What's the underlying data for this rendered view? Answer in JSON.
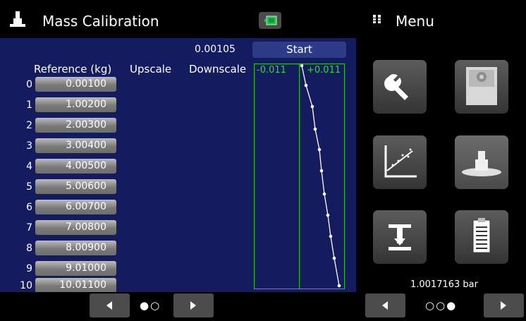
{
  "header": {
    "title": "Mass Calibration",
    "title_icon": "mass-weight-icon",
    "status_icon": "battery-icon",
    "menu_icon": "grid-dots-icon",
    "menu_title": "Menu"
  },
  "calibration": {
    "top_value": "0.00105",
    "start_label": "Start",
    "columns": {
      "reference": "Reference (kg)",
      "upscale": "Upscale",
      "downscale": "Downscale"
    },
    "rows": [
      {
        "index": "0",
        "reference": "0.00100"
      },
      {
        "index": "1",
        "reference": "1.00200"
      },
      {
        "index": "2",
        "reference": "2.00300"
      },
      {
        "index": "3",
        "reference": "3.00400"
      },
      {
        "index": "4",
        "reference": "4.00500"
      },
      {
        "index": "5",
        "reference": "5.00600"
      },
      {
        "index": "6",
        "reference": "6.00700"
      },
      {
        "index": "7",
        "reference": "7.00800"
      },
      {
        "index": "8",
        "reference": "8.00900"
      },
      {
        "index": "9",
        "reference": "9.01000"
      },
      {
        "index": "10",
        "reference": "10.01100"
      }
    ],
    "chart": {
      "left_label": "-0.011",
      "right_label": "+0.011",
      "colors": {
        "border": "#2bbf2b",
        "label": "#3ad33a",
        "line": "#ffffff"
      }
    },
    "page_dots": "●○"
  },
  "menu": {
    "items": [
      {
        "name": "settings",
        "icon": "wrench-icon"
      },
      {
        "name": "sensor",
        "icon": "sensor-icon"
      },
      {
        "name": "calibration-chart",
        "icon": "chart-icon"
      },
      {
        "name": "mass-calibration",
        "icon": "mass-weight-icon",
        "active": true
      },
      {
        "name": "leak-test",
        "icon": "leak-test-icon"
      },
      {
        "name": "report",
        "icon": "clipboard-icon"
      }
    ],
    "pressure_reading": "1.0017163 bar",
    "page_dots": "○○●"
  },
  "colors": {
    "panel": "#141b5e",
    "accent_button": "#2c3c87",
    "background": "#000000"
  }
}
